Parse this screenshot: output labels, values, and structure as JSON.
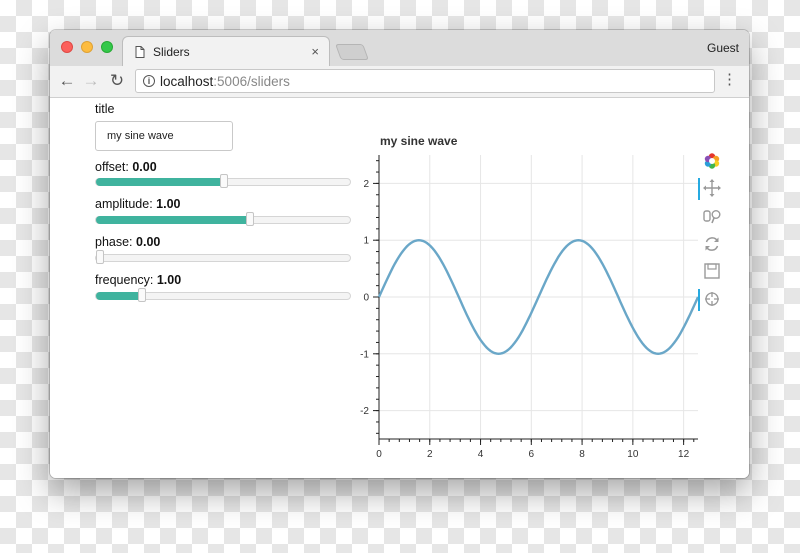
{
  "browser": {
    "tab_title": "Sliders",
    "tab_close": "×",
    "profile": "Guest",
    "url_host": "localhost",
    "url_rest": ":5006/sliders",
    "back": "←",
    "forward": "→",
    "reload": "↻",
    "menu": "⋮",
    "info": "i"
  },
  "controls": {
    "title_label": "title",
    "title_value": "my sine wave",
    "sliders": [
      {
        "label": "offset:",
        "value_text": "0.00",
        "value": 0.0,
        "min": -5,
        "max": 5
      },
      {
        "label": "amplitude:",
        "value_text": "1.00",
        "value": 1.0,
        "min": -5,
        "max": 5
      },
      {
        "label": "phase:",
        "value_text": "0.00",
        "value": 0.0,
        "min": 0,
        "max": 6.2832
      },
      {
        "label": "frequency:",
        "value_text": "1.00",
        "value": 1.0,
        "min": 0.1,
        "max": 5.1
      }
    ]
  },
  "plot": {
    "title": "my sine wave"
  },
  "plot_toolbar": [
    {
      "icon": "bokeh-logo-icon",
      "active": false
    },
    {
      "icon": "pan-icon",
      "active": true
    },
    {
      "icon": "box-zoom-icon",
      "active": false
    },
    {
      "icon": "reset-icon",
      "active": false
    },
    {
      "icon": "save-icon",
      "active": false
    },
    {
      "icon": "hover-icon",
      "active": true
    }
  ],
  "colors": {
    "slider_fill": "#3fb39e",
    "line": "#6aa7c8",
    "toolbar_active": "#26aae1"
  },
  "chart_data": {
    "type": "line",
    "title": "my sine wave",
    "xlabel": "",
    "ylabel": "",
    "xlim": [
      0,
      12.5664
    ],
    "ylim": [
      -2.5,
      2.5
    ],
    "x_ticks": [
      "0",
      "2",
      "4",
      "6",
      "8",
      "10",
      "12"
    ],
    "y_ticks": [
      "2",
      "1",
      "0",
      "-1",
      "-2"
    ],
    "grid": true,
    "series": [
      {
        "x": [
          0,
          0.785,
          1.571,
          2.356,
          3.142,
          3.927,
          4.712,
          5.498,
          6.283,
          7.069,
          7.854,
          8.639,
          9.425,
          10.21,
          10.996,
          11.781,
          12.566
        ],
        "y": [
          0,
          0.71,
          1.0,
          0.71,
          0,
          -0.71,
          -1.0,
          -0.71,
          0,
          0.71,
          1.0,
          0.71,
          0,
          -0.71,
          -1.0,
          -0.71,
          0
        ]
      }
    ]
  }
}
